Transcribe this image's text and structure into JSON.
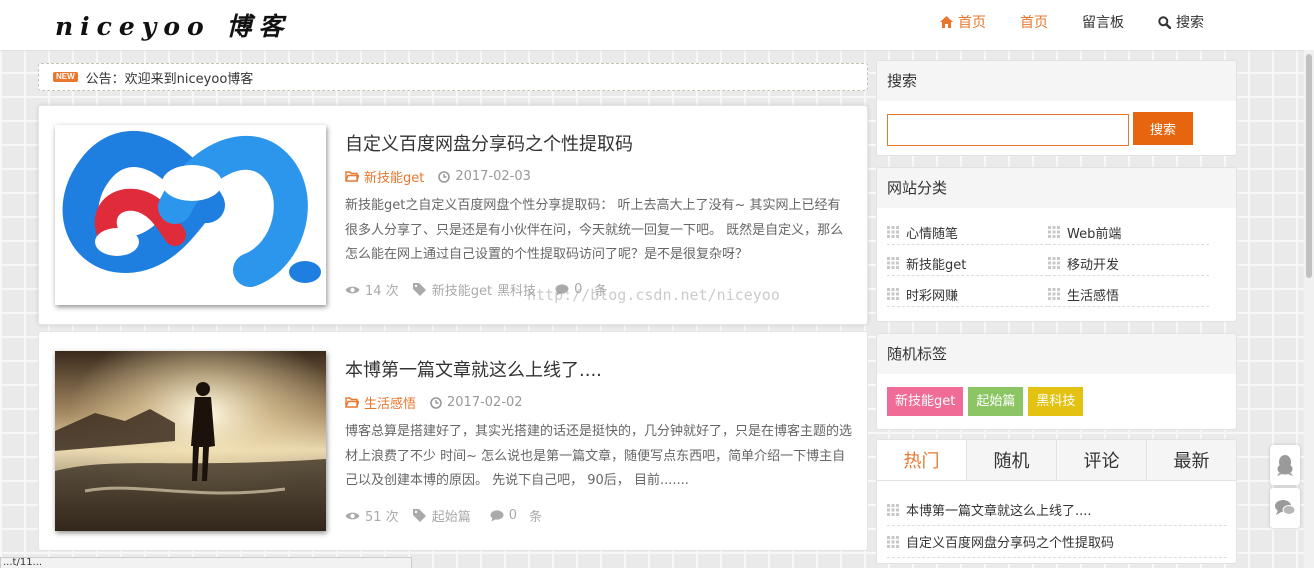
{
  "site": {
    "logo": "niceyoo 博客"
  },
  "nav": [
    {
      "label": "首页",
      "icon": "home-icon"
    },
    {
      "label": "首页"
    },
    {
      "label": "留言板"
    },
    {
      "label": "搜索",
      "icon": "search-icon"
    }
  ],
  "notice": {
    "badge": "NEW",
    "text": "公告：欢迎来到niceyoo博客"
  },
  "posts": [
    {
      "title": "自定义百度网盘分享码之个性提取码",
      "category": "新技能get",
      "date": "2017-02-03",
      "excerpt": "新技能get之自定义百度网盘个性分享提取码： 听上去高大上了没有~ 其实网上已经有很多人分享了、只是还是有小伙伴在问，今天就统一回复一下吧。 既然是自定义，那么怎么能在网上通过自己设置的个性提取码访问了呢？是不是很复杂呀？",
      "views": "14 次",
      "tags": [
        "新技能get",
        "黑科技"
      ],
      "comments": "0",
      "comments_unit": "条"
    },
    {
      "title": "本博第一篇文章就这么上线了....",
      "category": "生活感悟",
      "date": "2017-02-02",
      "excerpt": "博客总算是搭建好了，其实光搭建的话还是挺快的，几分钟就好了，只是在博客主题的选材上浪费了不少 时间~ 怎么说也是第一篇文章，随便写点东西吧，简单介绍一下博主自己以及创建本博的原因。 先说下自己吧， 90后， 目前.......",
      "views": "51 次",
      "tags": [
        "起始篇"
      ],
      "comments": "0",
      "comments_unit": "条"
    }
  ],
  "watermark": "http://blog.csdn.net/niceyoo",
  "sidebar": {
    "search": {
      "title": "搜索",
      "button": "搜索",
      "value": ""
    },
    "categories": {
      "title": "网站分类",
      "items": [
        "心情随笔",
        "Web前端",
        "新技能get",
        "移动开发",
        "时彩网赚",
        "生活感悟"
      ]
    },
    "tags": {
      "title": "随机标签",
      "items": [
        {
          "label": "新技能get",
          "color": "#f06c97"
        },
        {
          "label": "起始篇",
          "color": "#8cc563"
        },
        {
          "label": "黑科技",
          "color": "#e4c211"
        }
      ]
    },
    "tabs": {
      "labels": [
        "热门",
        "随机",
        "评论",
        "最新"
      ],
      "items": [
        "本博第一篇文章就这么上线了....",
        "自定义百度网盘分享码之个性提取码"
      ]
    }
  },
  "float_buttons": [
    "qq-icon",
    "comment-icon"
  ],
  "statusbar": "...t/11..."
}
